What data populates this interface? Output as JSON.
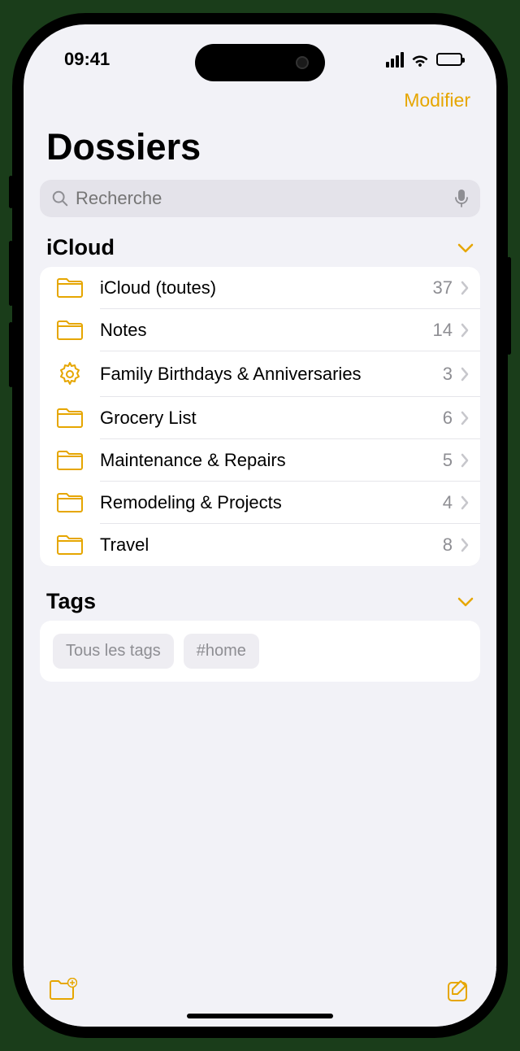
{
  "status": {
    "time": "09:41"
  },
  "nav": {
    "edit": "Modifier"
  },
  "title": "Dossiers",
  "search": {
    "placeholder": "Recherche"
  },
  "sections": {
    "icloud": {
      "title": "iCloud",
      "folders": [
        {
          "icon": "folder",
          "name": "iCloud (toutes)",
          "count": "37"
        },
        {
          "icon": "folder",
          "name": "Notes",
          "count": "14"
        },
        {
          "icon": "gear",
          "name": "Family Birthdays & Anniversaries",
          "count": "3"
        },
        {
          "icon": "folder",
          "name": "Grocery List",
          "count": "6"
        },
        {
          "icon": "folder",
          "name": "Maintenance & Repairs",
          "count": "5"
        },
        {
          "icon": "folder",
          "name": "Remodeling & Projects",
          "count": "4"
        },
        {
          "icon": "folder",
          "name": "Travel",
          "count": "8"
        }
      ]
    },
    "tags": {
      "title": "Tags",
      "items": [
        "Tous les tags",
        "#home"
      ]
    }
  },
  "colors": {
    "accent": "#e6a600"
  }
}
